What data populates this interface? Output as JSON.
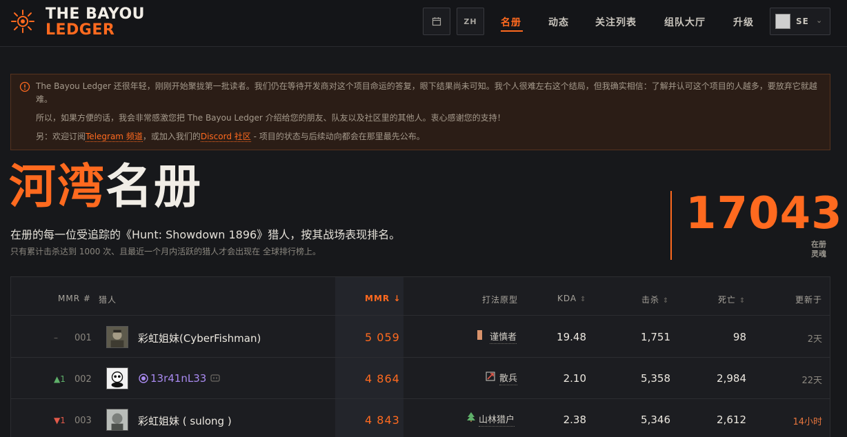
{
  "brand": {
    "line1": "THE BAYOU",
    "line2": "LEDGER"
  },
  "header": {
    "calendar_icon": "calendar-icon",
    "lang_label": "ZH",
    "nav": [
      {
        "label": "名册",
        "active": true
      },
      {
        "label": "动态",
        "active": false
      },
      {
        "label": "关注列表",
        "active": false
      },
      {
        "label": "组队大厅",
        "active": false
      },
      {
        "label": "升级",
        "active": false
      }
    ],
    "profile": {
      "name": "SE",
      "caret": "⌄"
    }
  },
  "notice": {
    "p1": "The Bayou Ledger 还很年轻，刚刚开始聚拢第一批读者。我们仍在等待开发商对这个项目命运的答复，眼下结果尚未可知。我个人很难左右这个结局，但我确实相信：了解并认可这个项目的人越多，要放弃它就越难。",
    "p2": "所以，如果方便的话，我会非常感激您把 The Bayou Ledger 介绍给您的朋友、队友以及社区里的其他人。衷心感谢您的支持！",
    "p3_prefix": "另：欢迎订阅",
    "p3_link1": "Telegram 频道",
    "p3_mid": "，或加入我们的",
    "p3_link2": "Discord 社区",
    "p3_suffix": " - 项目的状态与后续动向都会在那里最先公布。"
  },
  "hero": {
    "title_accent": "河湾",
    "title_plain": "名册",
    "subtitle": "在册的每一位受追踪的《Hunt: Showdown 1896》猎人，按其战场表现排名。",
    "note": "只有累计击杀达到 1000 次、且最近一个月内活跃的猎人才会出现在 全球排行榜上。",
    "count": "17043",
    "count_label_1": "在册",
    "count_label_2": "灵魂"
  },
  "table": {
    "headers": {
      "rank": "MMR #",
      "hunter": "猎人",
      "mmr": "MMR",
      "mmr_sort": "↓",
      "archetype": "打法原型",
      "kda": "KDA",
      "kills": "击杀",
      "deaths": "死亡",
      "updated": "更新于",
      "sort_glyph": "⇕"
    },
    "rows": [
      {
        "delta": "–",
        "delta_dir": "flat",
        "rank": "001",
        "name": "彩虹姐妹(CyberFishman)",
        "mmr": "5 059",
        "archetype": "谨慎者",
        "kda": "19.48",
        "kills": "1,751",
        "deaths": "98",
        "updated": "2天"
      },
      {
        "delta": "▲1",
        "delta_dir": "up",
        "rank": "002",
        "name": "13r41nL33",
        "mmr": "4 864",
        "archetype": "散兵",
        "kda": "2.10",
        "kills": "5,358",
        "deaths": "2,984",
        "updated": "22天"
      },
      {
        "delta": "▼1",
        "delta_dir": "down",
        "rank": "003",
        "name": "彩虹姐妹 ( sulong )",
        "mmr": "4 843",
        "archetype": "山林猎户",
        "kda": "2.38",
        "kills": "5,346",
        "deaths": "2,612",
        "updated": "14小时"
      }
    ]
  },
  "colors": {
    "accent": "#ff6a1f",
    "up": "#5fb06a",
    "down": "#e35a4a",
    "purple": "#a98af0"
  }
}
